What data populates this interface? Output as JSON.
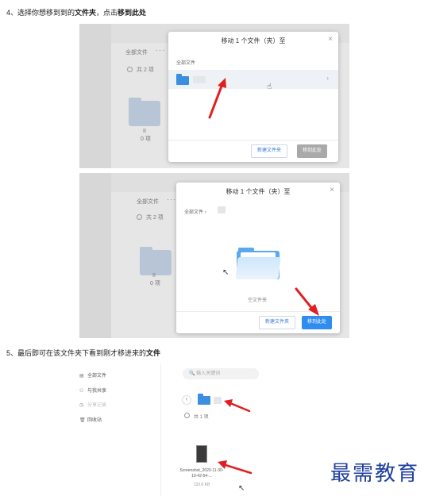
{
  "step4": {
    "prefix": "4、选择你想移到到的",
    "bold1": "文件夹",
    "middle": "，点击",
    "bold2": "移到此处"
  },
  "shot1": {
    "background": {
      "all_files": "全部文件",
      "more": "···",
      "count": "共 2 项",
      "folder_name": "II",
      "folder_meta": "0 项"
    },
    "dialog": {
      "title": "移动 1 个文件（夹）至",
      "close": "×",
      "breadcrumb": "全部文件",
      "row_chevron": "›",
      "new_folder": "新建文件夹",
      "move_here": "移到此处"
    }
  },
  "shot2": {
    "background": {
      "all_files": "全部文件",
      "more": "···",
      "count": "共 2 项",
      "folder_name": "II",
      "folder_meta": "0 项"
    },
    "dialog": {
      "title": "移动 1 个文件（夹）至",
      "close": "×",
      "breadcrumb": "全部文件  ›",
      "empty_text": "空文件夹",
      "new_folder": "新建文件夹",
      "move_here": "移到此处"
    }
  },
  "step5": {
    "prefix": "5、最后即可在该文件夹下看到刚才移进来的",
    "bold": "文件"
  },
  "shot3": {
    "sidebar": [
      {
        "icon": "▤",
        "label": "全部文件"
      },
      {
        "icon": "⚇",
        "label": "与我共享"
      },
      {
        "icon": "◷",
        "label": "分享记录"
      },
      {
        "icon": "🗑",
        "label": "回收站"
      }
    ],
    "search_placeholder": "🔍  输入关键词",
    "back": "‹",
    "count": "共 1 项",
    "file_name": "Screenshot_2020-11-30-10-42-54-...",
    "file_size": "133.6 KB"
  },
  "watermark": "最需教育",
  "colors": {
    "accent": "#2f8cf0",
    "folder": "#3c8fe0",
    "arrow": "#e02020",
    "watermark": "#1f3f9e"
  }
}
